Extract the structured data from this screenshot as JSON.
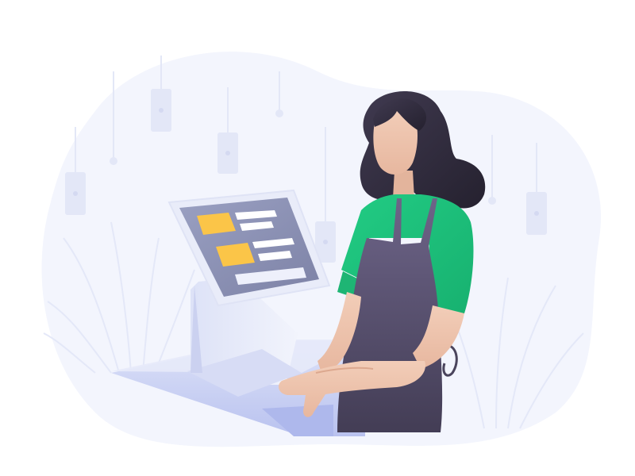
{
  "scene": {
    "subject": "cashier-at-pos-terminal",
    "icons": [
      "pos-terminal-icon",
      "hanging-lamp-icon",
      "plant-icon"
    ]
  },
  "colors": {
    "background": "#ffffff",
    "blob": "#f3f5fd",
    "plants": "#e6eaf9",
    "lamps": "#e3e7f7",
    "counter": "#c9d0f3",
    "terminal_frame": "#e6e9f8",
    "screen": "#8f93b4",
    "tile_yellow": "#fbc548",
    "tile_white": "#ffffff",
    "hair": "#332f40",
    "skin": "#f0c7b1",
    "shirt": "#22cc84",
    "apron": "#564f6e"
  },
  "pos_screen": {
    "tiles": 2,
    "lines_per_tile": 2,
    "footer_bars": 1
  }
}
